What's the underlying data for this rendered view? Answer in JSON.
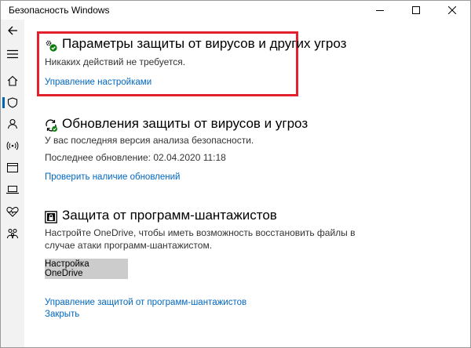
{
  "window": {
    "title": "Безопасность Windows",
    "controls": {
      "minimize": "minimize-icon",
      "maximize": "maximize-icon",
      "close": "close-icon"
    }
  },
  "sidebar": {
    "items": [
      {
        "icon": "back-arrow-icon",
        "active": false
      },
      {
        "icon": "hamburger-menu-icon",
        "active": false
      },
      {
        "icon": "home-icon",
        "active": false
      },
      {
        "icon": "shield-icon",
        "active": true
      },
      {
        "icon": "person-icon",
        "active": false
      },
      {
        "icon": "wireless-icon",
        "active": false
      },
      {
        "icon": "app-browser-icon",
        "active": false
      },
      {
        "icon": "laptop-icon",
        "active": false
      },
      {
        "icon": "heart-pulse-icon",
        "active": false
      },
      {
        "icon": "family-icon",
        "active": false
      }
    ],
    "accent": "#0063b1"
  },
  "virus_settings": {
    "icon": "gears-check-icon",
    "heading": "Параметры защиты от вирусов и других угроз",
    "status": "Никаких действий не требуется.",
    "link": "Управление настройками",
    "highlight_color": "#e3212e"
  },
  "updates": {
    "icon": "refresh-shield-icon",
    "heading": "Обновления защиты от вирусов и угроз",
    "status": "У вас последняя версия анализа безопасности.",
    "last_update": "Последнее обновление: 02.04.2020 11:18",
    "link": "Проверить наличие обновлений"
  },
  "ransomware": {
    "icon": "folder-lock-icon",
    "heading": "Защита от программ-шантажистов",
    "description_line1": "Настройте OneDrive, чтобы иметь возможность восстановить файлы в",
    "description_line2": "случае атаки программ-шантажистом.",
    "button": "Настройка OneDrive",
    "manage_link": "Управление защитой от программ-шантажистов",
    "close_link": "Закрыть"
  },
  "colors": {
    "link": "#0067c0",
    "button_bg": "#cccccc",
    "check_green": "#107c10"
  }
}
